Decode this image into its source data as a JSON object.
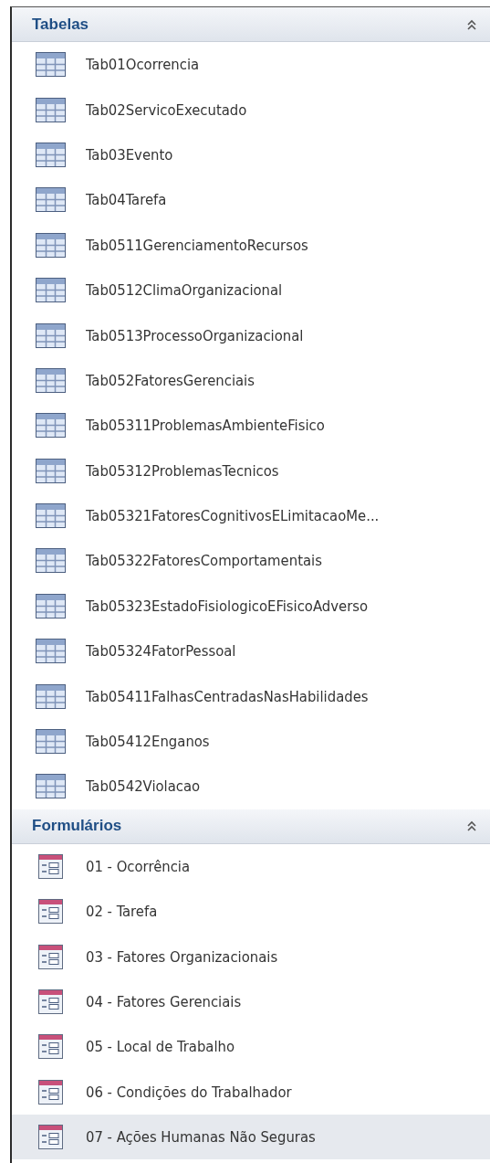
{
  "groups": [
    {
      "title": "Tabelas",
      "expanded": true,
      "kind": "table",
      "items": [
        {
          "label": "Tab01Ocorrencia",
          "selected": false
        },
        {
          "label": "Tab02ServicoExecutado",
          "selected": false
        },
        {
          "label": "Tab03Evento",
          "selected": false
        },
        {
          "label": "Tab04Tarefa",
          "selected": false
        },
        {
          "label": "Tab0511GerenciamentoRecursos",
          "selected": false
        },
        {
          "label": "Tab0512ClimaOrganizacional",
          "selected": false
        },
        {
          "label": "Tab0513ProcessoOrganizacional",
          "selected": false
        },
        {
          "label": "Tab052FatoresGerenciais",
          "selected": false
        },
        {
          "label": "Tab05311ProblemasAmbienteFisico",
          "selected": false
        },
        {
          "label": "Tab05312ProblemasTecnicos",
          "selected": false
        },
        {
          "label": "Tab05321FatoresCognitivosELimitacaoMe...",
          "selected": false
        },
        {
          "label": "Tab05322FatoresComportamentais",
          "selected": false
        },
        {
          "label": "Tab05323EstadoFisiologicoEFisicoAdverso",
          "selected": false
        },
        {
          "label": "Tab05324FatorPessoal",
          "selected": false
        },
        {
          "label": "Tab05411FalhasCentradasNasHabilidades",
          "selected": false
        },
        {
          "label": "Tab05412Enganos",
          "selected": false
        },
        {
          "label": "Tab0542Violacao",
          "selected": false
        }
      ]
    },
    {
      "title": "Formulários",
      "expanded": true,
      "kind": "form",
      "items": [
        {
          "label": "01 - Ocorrência",
          "selected": false
        },
        {
          "label": "02 - Tarefa",
          "selected": false
        },
        {
          "label": "03 - Fatores Organizacionais",
          "selected": false
        },
        {
          "label": "04 - Fatores Gerenciais",
          "selected": false
        },
        {
          "label": "05 - Local de Trabalho",
          "selected": false
        },
        {
          "label": "06 - Condições do Trabalhador",
          "selected": false
        },
        {
          "label": "07 - Ações Humanas Não Seguras",
          "selected": true
        }
      ]
    }
  ]
}
